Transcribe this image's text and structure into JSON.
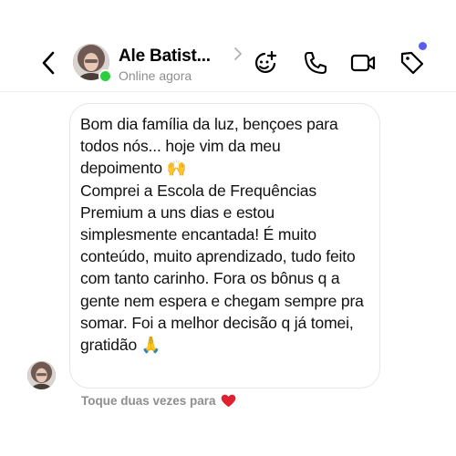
{
  "header": {
    "name": "Ale Batist...",
    "status": "Online agora",
    "icons": {
      "back": "chevron-left-icon",
      "profile_chevron": "chevron-right-icon",
      "effects": "sticker-effects-icon",
      "call": "phone-icon",
      "video": "video-camera-icon",
      "tag": "tag-icon"
    },
    "colors": {
      "online": "#2ecc40",
      "notification": "#5b5bf5"
    }
  },
  "message": {
    "text": "Bom dia família da luz, bençoes para todos nós... hoje vim da meu depoimento 🙌\nComprei a Escola de Frequências Premium a uns dias e estou simplesmente encantada! É muito conteúdo, muito aprendizado, tudo feito com tanto carinho. Fora os bônus q a gente nem espera e chegam sempre pra somar. Foi a melhor decisão q já tomei, gratidão 🙏"
  },
  "footer": {
    "hint": "Toque duas vezes para",
    "hint_icon": "heart-icon",
    "heart_color": "#e0202e"
  }
}
